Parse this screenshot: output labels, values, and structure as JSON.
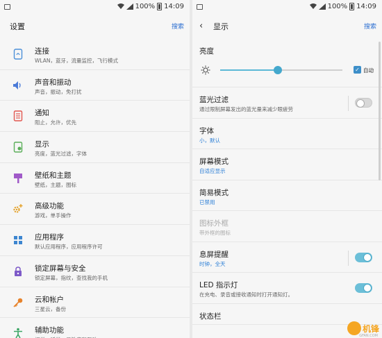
{
  "status": {
    "battery": "100%",
    "time": "14:09"
  },
  "left": {
    "title": "设置",
    "search": "搜索",
    "items": [
      {
        "title": "连接",
        "sub": "WLAN，蓝牙，流量监控，飞行模式",
        "icon": "link-icon",
        "color": "#4b8fd8"
      },
      {
        "title": "声音和振动",
        "sub": "声音，振动，免打扰",
        "icon": "speaker-icon",
        "color": "#4b7bd8"
      },
      {
        "title": "通知",
        "sub": "阻止，允许，优先",
        "icon": "notification-icon",
        "color": "#e2564f"
      },
      {
        "title": "显示",
        "sub": "亮度，蓝光过滤，字体",
        "icon": "display-icon",
        "color": "#5aae58"
      },
      {
        "title": "壁纸和主题",
        "sub": "壁纸，主题，图标",
        "icon": "brush-icon",
        "color": "#a05ac8"
      },
      {
        "title": "高级功能",
        "sub": "游戏，单手操作",
        "icon": "gear-plus-icon",
        "color": "#e4a22a"
      },
      {
        "title": "应用程序",
        "sub": "默认应用程序，应用程序许可",
        "icon": "apps-grid-icon",
        "color": "#3d86d0"
      },
      {
        "title": "锁定屏幕与安全",
        "sub": "锁定屏幕，指纹，查找我的手机",
        "icon": "lock-icon",
        "color": "#7d5ac8"
      },
      {
        "title": "云和帐户",
        "sub": "三星云，备份",
        "icon": "key-icon",
        "color": "#e7832c"
      },
      {
        "title": "辅助功能",
        "sub": "视觉，听觉，灵敏度和互动",
        "icon": "accessibility-icon",
        "color": "#3aa564"
      }
    ]
  },
  "right": {
    "title": "显示",
    "search": "搜索",
    "brightness": {
      "title": "亮度",
      "level": 0.47,
      "auto_label": "自动"
    },
    "items": [
      {
        "title": "蓝光过滤",
        "sub": "通过限制屏幕发出的蓝光量来减少眼疲劳",
        "toggle": "off"
      },
      {
        "title": "字体",
        "sub": "小，默认",
        "blue": true
      },
      {
        "title": "屏幕模式",
        "sub": "自适应显示",
        "blue": true
      },
      {
        "title": "简易模式",
        "sub": "已禁用",
        "blue": true
      },
      {
        "title": "图标外框",
        "sub": "带外框的图标",
        "disabled": true
      },
      {
        "title": "息屏提醒",
        "sub": "时钟，全天",
        "blue": true,
        "toggle": "on",
        "sep": true
      },
      {
        "title": "LED 指示灯",
        "sub": "在充电、录音或接收通知时打开通知灯。",
        "toggle": "on"
      },
      {
        "title": "状态栏",
        "sub": ""
      }
    ]
  },
  "watermark": {
    "brand": "机锋",
    "sub": "GFAN.COM"
  }
}
